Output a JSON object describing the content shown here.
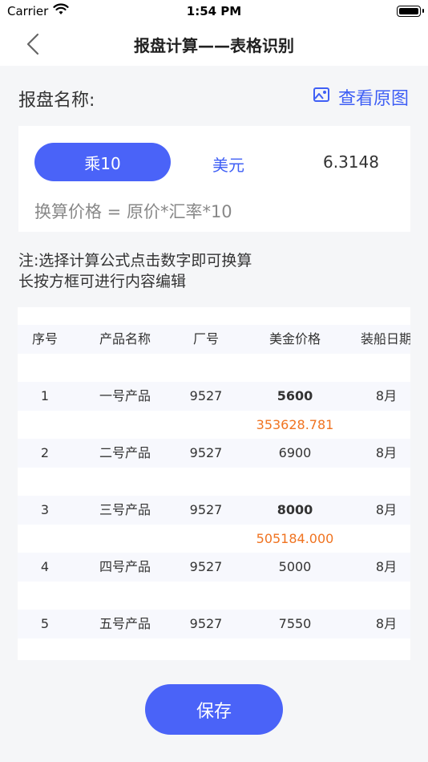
{
  "status_bar": {
    "carrier": "Carrier",
    "time": "1:54 PM"
  },
  "nav": {
    "title": "报盘计算——表格识别"
  },
  "offer": {
    "label": "报盘名称:",
    "view_original": "查看原图"
  },
  "formula": {
    "mode": "乘10",
    "currency": "美元",
    "rate": "6.3148",
    "expression": "换算价格 = 原价*汇率*10"
  },
  "note": {
    "line1": "注:选择计算公式点击数字即可换算",
    "line2": "长按方框可进行内容编辑"
  },
  "table": {
    "headers": [
      "序号",
      "产品名称",
      "厂号",
      "美金价格",
      "装船日期"
    ],
    "rows": [
      {
        "no": "1",
        "name": "一号产品",
        "factory": "9527",
        "price": "5600",
        "date": "8月",
        "converted": "353628.781",
        "selected": true
      },
      {
        "no": "2",
        "name": "二号产品",
        "factory": "9527",
        "price": "6900",
        "date": "8月",
        "converted": "",
        "selected": false
      },
      {
        "no": "3",
        "name": "三号产品",
        "factory": "9527",
        "price": "8000",
        "date": "8月",
        "converted": "505184.000",
        "selected": true
      },
      {
        "no": "4",
        "name": "四号产品",
        "factory": "9527",
        "price": "5000",
        "date": "8月",
        "converted": "",
        "selected": false
      },
      {
        "no": "5",
        "name": "五号产品",
        "factory": "9527",
        "price": "7550",
        "date": "8月",
        "converted": "",
        "selected": false
      }
    ]
  },
  "actions": {
    "save": "保存"
  },
  "colors": {
    "accent": "#4a63f8",
    "converted": "#f07320",
    "row_shade": "#f7f8fd"
  },
  "icons": {
    "back": "chevron-left-icon",
    "image": "image-icon",
    "wifi": "wifi-icon",
    "battery": "battery-icon"
  }
}
